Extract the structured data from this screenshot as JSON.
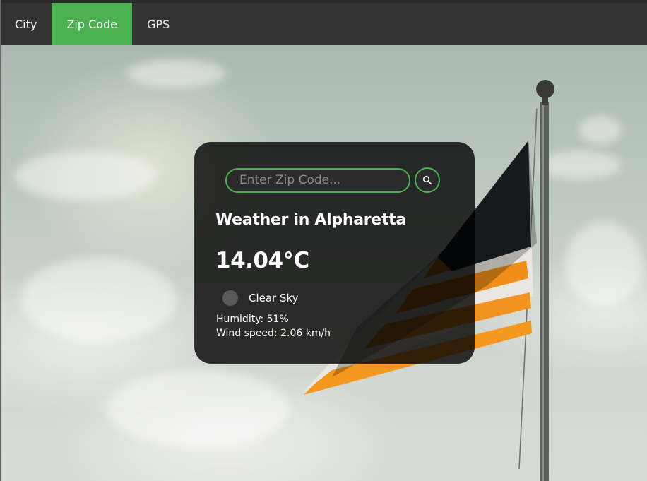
{
  "nav": {
    "tabs": [
      {
        "label": "City",
        "active": false
      },
      {
        "label": "Zip Code",
        "active": true
      },
      {
        "label": "GPS",
        "active": false
      }
    ]
  },
  "search": {
    "placeholder": "Enter Zip Code...",
    "value": "",
    "button_icon": "search-icon"
  },
  "weather": {
    "title": "Weather in Alpharetta",
    "temperature": "14.04°C",
    "icon": "weather-icon",
    "description": "Clear Sky",
    "humidity": "Humidity: 51%",
    "wind": "Wind speed: 2.06 km/h"
  },
  "colors": {
    "accent": "#4caf50",
    "nav_bg": "#333333",
    "card_bg": "rgba(0,0,0,0.8)",
    "text": "#ffffff"
  }
}
